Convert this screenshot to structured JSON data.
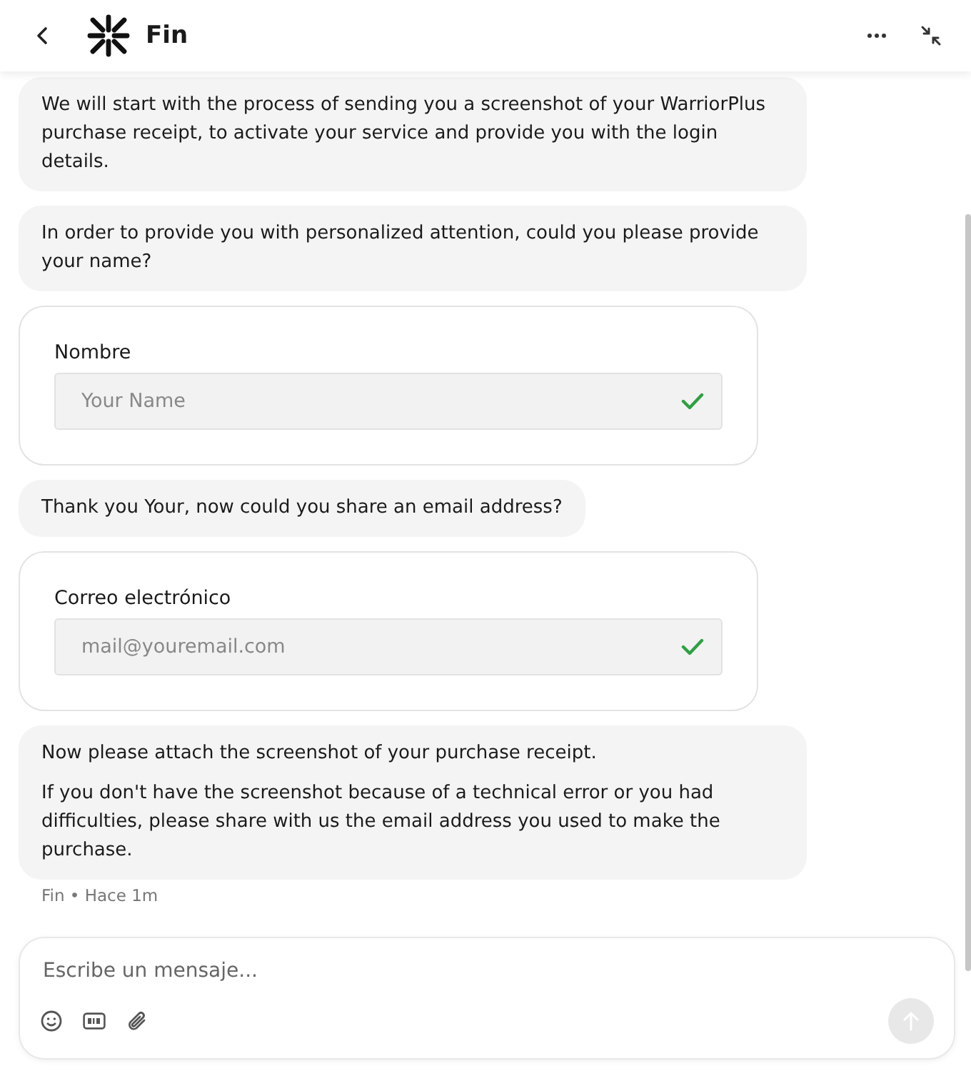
{
  "header": {
    "title": "Fin"
  },
  "messages": [
    {
      "kind": "text",
      "paragraphs": [
        "We will start with the process of sending you a screenshot of your WarriorPlus purchase receipt, to activate your service and provide you with the login details."
      ]
    },
    {
      "kind": "text",
      "paragraphs": [
        "In order to provide you with personalized attention, could you please provide your name?"
      ]
    },
    {
      "kind": "form",
      "label": "Nombre",
      "placeholder": "Your Name",
      "submitted": true
    },
    {
      "kind": "text",
      "paragraphs": [
        "Thank you Your, now could you share an email address?"
      ]
    },
    {
      "kind": "form",
      "label": "Correo electrónico",
      "placeholder": "mail@youremail.com",
      "submitted": true
    },
    {
      "kind": "text",
      "paragraphs": [
        "Now please attach the screenshot of your purchase receipt.",
        "If you don't have the screenshot because of a technical error or you had difficulties, please share with us the email address you used to make the purchase."
      ]
    }
  ],
  "meta": "Fin • Hace 1m",
  "composer": {
    "placeholder": "Escribe un mensaje...",
    "send_disabled": true
  }
}
